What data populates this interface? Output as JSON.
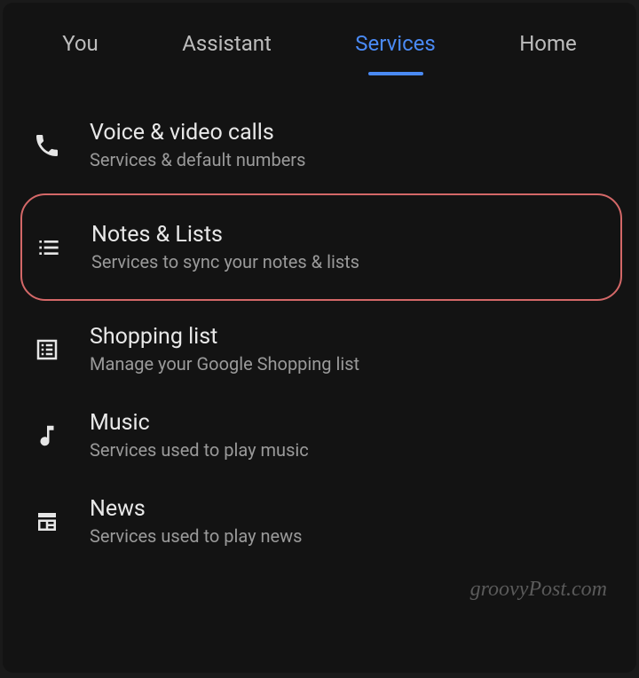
{
  "tabs": [
    {
      "label": "You",
      "active": false
    },
    {
      "label": "Assistant",
      "active": false
    },
    {
      "label": "Services",
      "active": true
    },
    {
      "label": "Home",
      "active": false
    }
  ],
  "items": [
    {
      "icon": "phone-icon",
      "title": "Voice & video calls",
      "subtitle": "Services & default numbers",
      "highlighted": false
    },
    {
      "icon": "list-icon",
      "title": "Notes & Lists",
      "subtitle": "Services to sync your notes & lists",
      "highlighted": true
    },
    {
      "icon": "document-list-icon",
      "title": "Shopping list",
      "subtitle": "Manage your Google Shopping list",
      "highlighted": false
    },
    {
      "icon": "music-note-icon",
      "title": "Music",
      "subtitle": "Services used to play music",
      "highlighted": false
    },
    {
      "icon": "news-icon",
      "title": "News",
      "subtitle": "Services used to play news",
      "highlighted": false
    }
  ],
  "watermark": "groovyPost.com"
}
